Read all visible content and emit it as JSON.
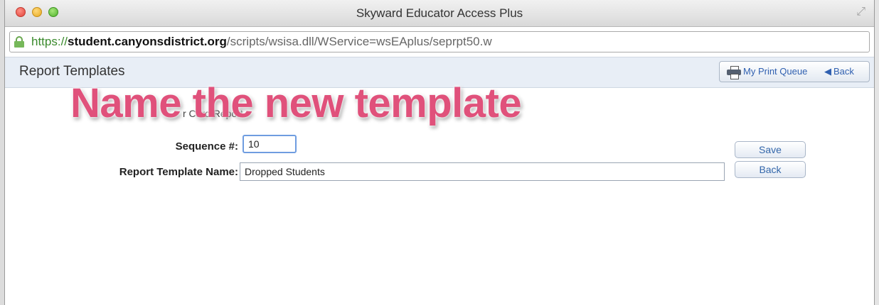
{
  "window": {
    "title": "Skyward Educator Access Plus",
    "url_scheme": "https://",
    "url_host": "student.canyonsdistrict.org",
    "url_path": "/scripts/wsisa.dll/WService=wsEAplus/seprpt50.w"
  },
  "header": {
    "title": "Report Templates",
    "print_queue_label": "My Print Queue",
    "back_label": "Back"
  },
  "instruction_text": "r                                                    Card Report.",
  "overlay_caption": "Name the new template",
  "form": {
    "sequence_label": "Sequence #:",
    "sequence_value": "10",
    "template_name_label": "Report Template Name:",
    "template_name_value": "Dropped Students"
  },
  "buttons": {
    "save_label": "Save",
    "back_label": "Back"
  },
  "colors": {
    "overlay_text": "#e0517b",
    "link": "#3060b0",
    "header_band": "#e8eef6"
  }
}
